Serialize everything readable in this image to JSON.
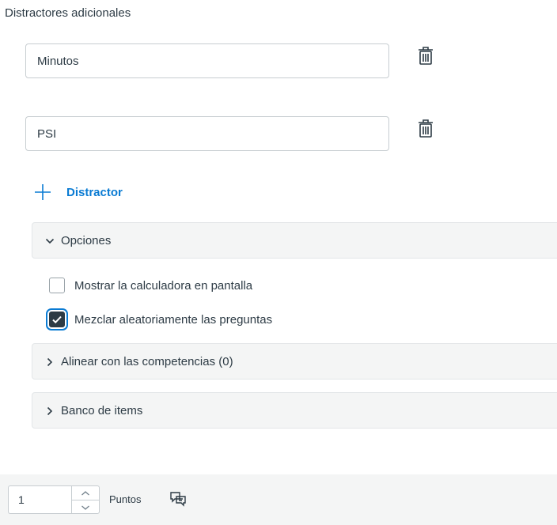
{
  "section": {
    "title": "Distractores adicionales"
  },
  "distractors": [
    {
      "value": "Minutos",
      "delete_icon": "trash-icon"
    },
    {
      "value": "PSI",
      "delete_icon": "trash-icon"
    }
  ],
  "add_distractor": {
    "label": "Distractor",
    "icon": "plus-icon"
  },
  "options_panel": {
    "label": "Opciones",
    "expanded": true
  },
  "checkboxes": [
    {
      "label": "Mostrar la calculadora en pantalla",
      "checked": false
    },
    {
      "label": "Mezclar aleatoriamente las preguntas",
      "checked": true
    }
  ],
  "outcomes_panel": {
    "label": "Alinear con las competencias (0)",
    "expanded": false
  },
  "item_bank_panel": {
    "label": "Banco de items",
    "expanded": false
  },
  "footer": {
    "points_value": "1",
    "points_label": "Puntos",
    "feedback_icon": "feedback-icon"
  },
  "colors": {
    "accent": "#0a7bd3",
    "text": "#2d3b45",
    "panel_bg": "#f4f5f5"
  }
}
